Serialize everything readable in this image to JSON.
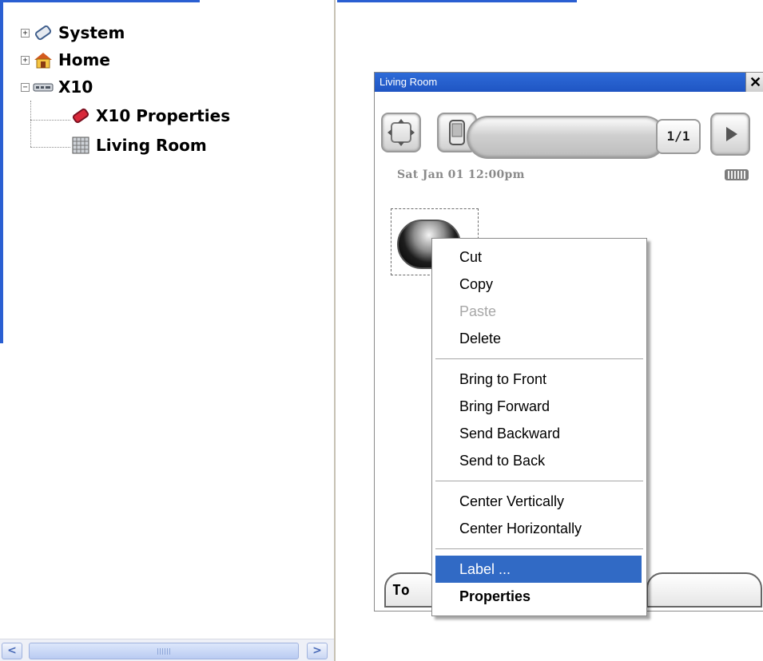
{
  "tree": {
    "nodes": [
      {
        "label": "System",
        "expander": "+",
        "icon": "system-icon"
      },
      {
        "label": "Home",
        "expander": "+",
        "icon": "home-icon"
      },
      {
        "label": "X10",
        "expander": "−",
        "icon": "x10-device-icon"
      },
      {
        "label": "X10 Properties",
        "icon": "properties-icon"
      },
      {
        "label": "Living Room",
        "icon": "panel-grid-icon"
      }
    ]
  },
  "designer": {
    "window_title": "Living Room",
    "close_glyph": "✕",
    "page_indicator": "1/1",
    "date_text": "Sat Jan 01 12:00pm",
    "bottom_button_text": "To",
    "icons": {
      "move": "move-arrows-icon",
      "device": "handheld-device-icon",
      "next": "play-arrow-icon",
      "battery": "battery-icon"
    }
  },
  "context_menu": {
    "groups": [
      [
        {
          "label": "Cut",
          "state": "enabled"
        },
        {
          "label": "Copy",
          "state": "enabled"
        },
        {
          "label": "Paste",
          "state": "disabled"
        },
        {
          "label": "Delete",
          "state": "enabled"
        }
      ],
      [
        {
          "label": "Bring to Front",
          "state": "enabled"
        },
        {
          "label": "Bring Forward",
          "state": "enabled"
        },
        {
          "label": "Send Backward",
          "state": "enabled"
        },
        {
          "label": "Send to Back",
          "state": "enabled"
        }
      ],
      [
        {
          "label": "Center Vertically",
          "state": "enabled"
        },
        {
          "label": "Center Horizontally",
          "state": "enabled"
        }
      ],
      [
        {
          "label": "Label ...",
          "state": "selected"
        },
        {
          "label": "Properties",
          "state": "bold"
        }
      ]
    ]
  },
  "scrollbar": {
    "left_glyph": "<",
    "right_glyph": ">"
  },
  "colors": {
    "selection": "#316ac5",
    "titlebar": "#2e6bd8",
    "disabled_text": "#a7a7a7"
  }
}
